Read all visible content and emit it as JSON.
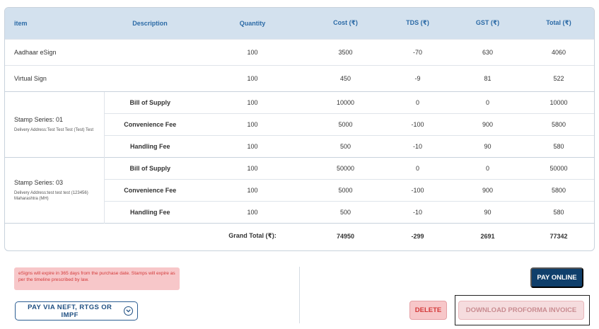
{
  "table": {
    "headers": [
      "item",
      "Description",
      "Quantity",
      "Cost (₹)",
      "TDS (₹)",
      "GST (₹)",
      "Total (₹)"
    ],
    "simple_rows": [
      {
        "item": "Aadhaar eSign",
        "quantity": "100",
        "cost": "3500",
        "tds": "-70",
        "gst": "630",
        "total": "4060"
      },
      {
        "item": "Virtual Sign",
        "quantity": "100",
        "cost": "450",
        "tds": "-9",
        "gst": "81",
        "total": "522"
      }
    ],
    "series": [
      {
        "title": "Stamp Series: 01",
        "address": "Delivery Address:Test Test Test (Test) Test",
        "rows": [
          {
            "description": "Bill of Supply",
            "quantity": "100",
            "cost": "10000",
            "tds": "0",
            "gst": "0",
            "total": "10000"
          },
          {
            "description": "Convenience Fee",
            "quantity": "100",
            "cost": "5000",
            "tds": "-100",
            "gst": "900",
            "total": "5800"
          },
          {
            "description": "Handling Fee",
            "quantity": "100",
            "cost": "500",
            "tds": "-10",
            "gst": "90",
            "total": "580"
          }
        ]
      },
      {
        "title": "Stamp Series: 03",
        "address": "Delivery Address:test test test (123456) Maharashtra (MH)",
        "rows": [
          {
            "description": "Bill of Supply",
            "quantity": "100",
            "cost": "50000",
            "tds": "0",
            "gst": "0",
            "total": "50000"
          },
          {
            "description": "Convenience Fee",
            "quantity": "100",
            "cost": "5000",
            "tds": "-100",
            "gst": "900",
            "total": "5800"
          },
          {
            "description": "Handling Fee",
            "quantity": "100",
            "cost": "500",
            "tds": "-10",
            "gst": "90",
            "total": "580"
          }
        ]
      }
    ],
    "grand_total": {
      "label": "Grand Total (₹):",
      "cost": "74950",
      "tds": "-299",
      "gst": "2691",
      "total": "77342"
    }
  },
  "notice": "eSigns will expire in 365 days from the purchase date. Stamps will expire as per the timeline prescribed by law.",
  "buttons": {
    "pay_neft": "PAY VIA NEFT, RTGS OR IMPF",
    "pay_online": "PAY ONLINE",
    "delete": "DELETE",
    "download": "DOWNLOAD PROFORMA INVOICE"
  },
  "colors": {
    "header_bg": "#d3e1ee",
    "header_text": "#2b6aa6",
    "primary": "#0f3f6b",
    "danger_bg": "#f7c7c9",
    "danger_text": "#d33a3a"
  },
  "icons": {
    "neft_chevron": "chevron-down-circle-icon"
  }
}
